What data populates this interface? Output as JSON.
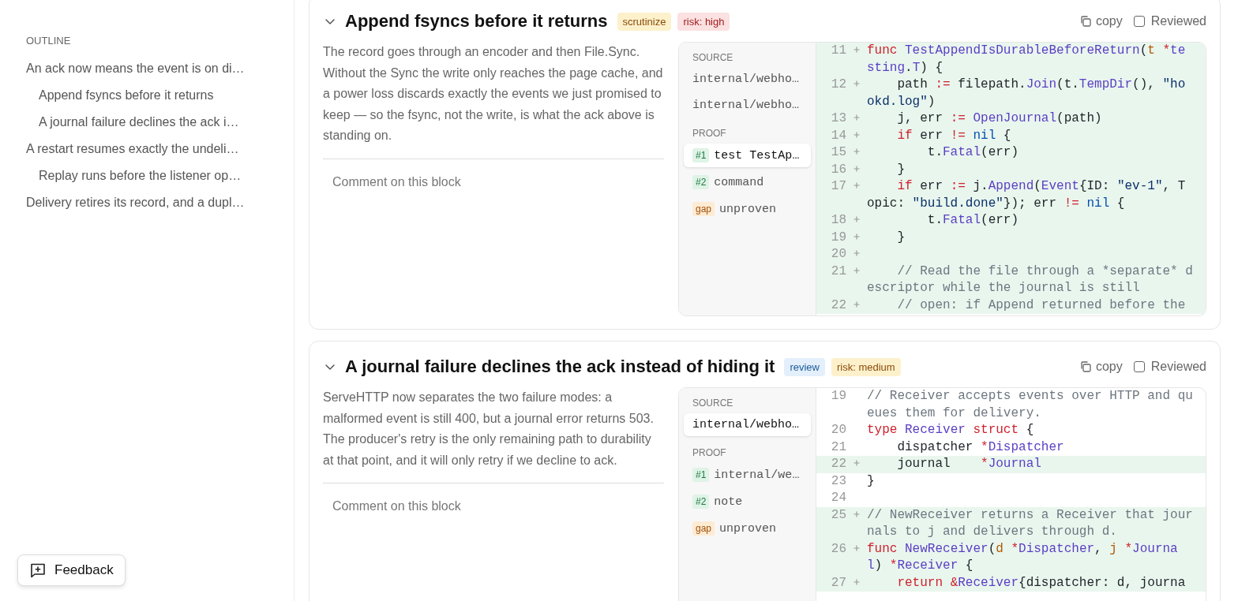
{
  "sidebar": {
    "heading": "OUTLINE",
    "items": [
      {
        "label": "An ack now means the event is on di…",
        "children": [
          {
            "label": "Append fsyncs before it returns"
          },
          {
            "label": "A journal failure declines the ack i…"
          }
        ]
      },
      {
        "label": "A restart resumes exactly the undeli…",
        "children": [
          {
            "label": "Replay runs before the listener op…"
          }
        ]
      },
      {
        "label": "Delivery retires its record, and a dupl…"
      }
    ]
  },
  "blocks": [
    {
      "expanded": true,
      "title": "Append fsyncs before it returns",
      "tags": [
        {
          "label": "scrutinize",
          "kind": "caution"
        },
        {
          "label": "risk: high",
          "kind": "danger"
        }
      ],
      "copy_label": "copy",
      "reviewed": {
        "label": "Reviewed",
        "checked": false
      },
      "description": "The record goes through an encoder and then File.Sync. Without the Sync the write only reaches the page cache, and a power loss discards exactly the events we just promised to keep — so the fsync, not the write, is what the ack above is standing on.",
      "comment": {
        "placeholder": "Comment on this block"
      },
      "source": {
        "heading": "SOURCE",
        "items": [
          {
            "label": "internal/webho…",
            "selected": false
          },
          {
            "label": "internal/webho…",
            "selected": false
          }
        ]
      },
      "proof": {
        "heading": "PROOF",
        "items": [
          {
            "badge": "#1",
            "kind": "proof",
            "label": "test TestAp…",
            "selected": true
          },
          {
            "badge": "#2",
            "kind": "proof",
            "label": "command",
            "selected": false
          },
          {
            "badge": "gap",
            "kind": "gap",
            "label": "unproven",
            "selected": false
          }
        ]
      },
      "code": [
        {
          "number": "11",
          "added": true,
          "tokens": [
            {
              "kind": "keyword",
              "text": "func "
            },
            {
              "kind": "name",
              "text": "TestAppendIsDurableBeforeReturn"
            },
            {
              "kind": "plain",
              "text": "("
            },
            {
              "kind": "param",
              "text": "t "
            },
            {
              "kind": "operator",
              "text": "*"
            },
            {
              "kind": "name",
              "text": "testing"
            },
            {
              "kind": "plain",
              "text": "."
            },
            {
              "kind": "name",
              "text": "T"
            },
            {
              "kind": "plain",
              "text": ") {"
            }
          ]
        },
        {
          "number": "12",
          "added": true,
          "tokens": [
            {
              "kind": "plain",
              "text": "    path "
            },
            {
              "kind": "operator",
              "text": ":="
            },
            {
              "kind": "plain",
              "text": " filepath."
            },
            {
              "kind": "name",
              "text": "Join"
            },
            {
              "kind": "plain",
              "text": "(t."
            },
            {
              "kind": "name",
              "text": "TempDir"
            },
            {
              "kind": "plain",
              "text": "(), "
            },
            {
              "kind": "string",
              "text": "\"hookd.log\""
            },
            {
              "kind": "plain",
              "text": ")"
            }
          ]
        },
        {
          "number": "13",
          "added": true,
          "tokens": [
            {
              "kind": "plain",
              "text": "    j, err "
            },
            {
              "kind": "operator",
              "text": ":="
            },
            {
              "kind": "name",
              "text": " OpenJournal"
            },
            {
              "kind": "plain",
              "text": "(path)"
            }
          ]
        },
        {
          "number": "14",
          "added": true,
          "tokens": [
            {
              "kind": "keyword",
              "text": "    if"
            },
            {
              "kind": "plain",
              "text": " err "
            },
            {
              "kind": "operator",
              "text": "!="
            },
            {
              "kind": "constant",
              "text": " nil"
            },
            {
              "kind": "plain",
              "text": " {"
            }
          ]
        },
        {
          "number": "15",
          "added": true,
          "tokens": [
            {
              "kind": "plain",
              "text": "        t."
            },
            {
              "kind": "name",
              "text": "Fatal"
            },
            {
              "kind": "plain",
              "text": "(err)"
            }
          ]
        },
        {
          "number": "16",
          "added": true,
          "tokens": [
            {
              "kind": "plain",
              "text": "    }"
            }
          ]
        },
        {
          "number": "17",
          "added": true,
          "tokens": [
            {
              "kind": "keyword",
              "text": "    if"
            },
            {
              "kind": "plain",
              "text": " err "
            },
            {
              "kind": "operator",
              "text": ":="
            },
            {
              "kind": "plain",
              "text": " j."
            },
            {
              "kind": "name",
              "text": "Append"
            },
            {
              "kind": "plain",
              "text": "("
            },
            {
              "kind": "name",
              "text": "Event"
            },
            {
              "kind": "plain",
              "text": "{ID: "
            },
            {
              "kind": "string",
              "text": "\"ev-1\""
            },
            {
              "kind": "plain",
              "text": ", Topic: "
            },
            {
              "kind": "string",
              "text": "\"build.done\""
            },
            {
              "kind": "plain",
              "text": "}); err "
            },
            {
              "kind": "operator",
              "text": "!="
            },
            {
              "kind": "constant",
              "text": " nil"
            },
            {
              "kind": "plain",
              "text": " {"
            }
          ]
        },
        {
          "number": "18",
          "added": true,
          "tokens": [
            {
              "kind": "plain",
              "text": "        t."
            },
            {
              "kind": "name",
              "text": "Fatal"
            },
            {
              "kind": "plain",
              "text": "(err)"
            }
          ]
        },
        {
          "number": "19",
          "added": true,
          "tokens": [
            {
              "kind": "plain",
              "text": "    }"
            }
          ]
        },
        {
          "number": "20",
          "added": true
        },
        {
          "number": "21",
          "added": true,
          "tokens": [
            {
              "kind": "comment",
              "text": "    // Read the file through a *separate* descriptor while the journal is still"
            }
          ]
        },
        {
          "number": "22",
          "added": true,
          "tokens": [
            {
              "kind": "comment",
              "text": "    // open: if Append returned before the"
            }
          ]
        }
      ]
    },
    {
      "expanded": true,
      "title": "A journal failure declines the ack instead of hiding it",
      "tags": [
        {
          "label": "review",
          "kind": "info"
        },
        {
          "label": "risk: medium",
          "kind": "caution"
        }
      ],
      "copy_label": "copy",
      "reviewed": {
        "label": "Reviewed",
        "checked": false
      },
      "description": "ServeHTTP now separates the two failure modes: a malformed event is still 400, but a journal error returns 503. The producer's retry is the only remaining path to durability at that point, and it will only retry if we decline to ack.",
      "comment": {
        "placeholder": "Comment on this block"
      },
      "source": {
        "heading": "SOURCE",
        "items": [
          {
            "label": "internal/webho…",
            "selected": true
          }
        ]
      },
      "proof": {
        "heading": "PROOF",
        "items": [
          {
            "badge": "#1",
            "kind": "proof",
            "label": "internal/we…",
            "selected": false
          },
          {
            "badge": "#2",
            "kind": "proof",
            "label": "note",
            "selected": false
          },
          {
            "badge": "gap",
            "kind": "gap",
            "label": "unproven",
            "selected": false
          }
        ]
      },
      "code": [
        {
          "number": "19",
          "added": false,
          "tokens": [
            {
              "kind": "comment",
              "text": "// Receiver accepts events over HTTP and queues them for delivery."
            }
          ]
        },
        {
          "number": "20",
          "added": false,
          "tokens": [
            {
              "kind": "keyword",
              "text": "type "
            },
            {
              "kind": "name",
              "text": "Receiver "
            },
            {
              "kind": "keyword",
              "text": "struct"
            },
            {
              "kind": "plain",
              "text": " {"
            }
          ]
        },
        {
          "number": "21",
          "added": false,
          "tokens": [
            {
              "kind": "plain",
              "text": "    dispatcher "
            },
            {
              "kind": "operator",
              "text": "*"
            },
            {
              "kind": "name",
              "text": "Dispatcher"
            }
          ]
        },
        {
          "number": "22",
          "added": true,
          "tokens": [
            {
              "kind": "plain",
              "text": "    journal    "
            },
            {
              "kind": "operator",
              "text": "*"
            },
            {
              "kind": "name",
              "text": "Journal"
            }
          ]
        },
        {
          "number": "23",
          "added": false,
          "tokens": [
            {
              "kind": "plain",
              "text": "}"
            }
          ]
        },
        {
          "number": "24",
          "added": false
        },
        {
          "number": "25",
          "added": true,
          "tokens": [
            {
              "kind": "comment",
              "text": "// NewReceiver returns a Receiver that journals to j and delivers through d."
            }
          ]
        },
        {
          "number": "26",
          "added": true,
          "tokens": [
            {
              "kind": "keyword",
              "text": "func "
            },
            {
              "kind": "name",
              "text": "NewReceiver"
            },
            {
              "kind": "plain",
              "text": "("
            },
            {
              "kind": "param",
              "text": "d "
            },
            {
              "kind": "operator",
              "text": "*"
            },
            {
              "kind": "name",
              "text": "Dispatcher"
            },
            {
              "kind": "plain",
              "text": ", "
            },
            {
              "kind": "param",
              "text": "j "
            },
            {
              "kind": "operator",
              "text": "*"
            },
            {
              "kind": "name",
              "text": "Journal"
            },
            {
              "kind": "plain",
              "text": ") "
            },
            {
              "kind": "operator",
              "text": "*"
            },
            {
              "kind": "name",
              "text": "Receiver"
            },
            {
              "kind": "plain",
              "text": " {"
            }
          ]
        },
        {
          "number": "27",
          "added": true,
          "tokens": [
            {
              "kind": "keyword",
              "text": "    return "
            },
            {
              "kind": "operator",
              "text": "&"
            },
            {
              "kind": "name",
              "text": "Receiver"
            },
            {
              "kind": "plain",
              "text": "{dispatcher: d, journa"
            }
          ]
        }
      ]
    }
  ],
  "feedback_button": {
    "label": "Feedback"
  }
}
